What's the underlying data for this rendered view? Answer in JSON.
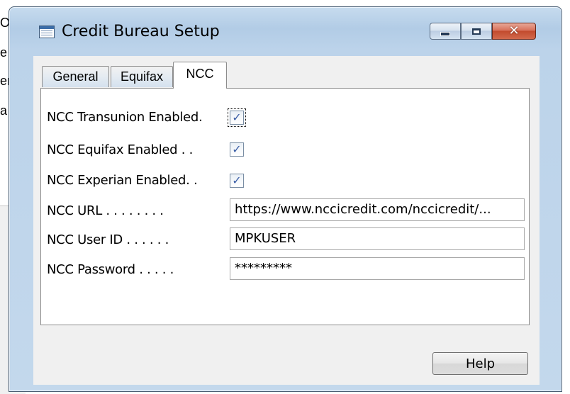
{
  "background": {
    "fragments": [
      "Of",
      "e",
      "er",
      "a"
    ]
  },
  "window": {
    "title": "Credit Bureau Setup",
    "icon": "table-window-icon",
    "controls": {
      "minimize": "minimize-icon",
      "maximize": "maximize-icon",
      "close": "✕"
    }
  },
  "tabs": [
    {
      "label": "General",
      "active": false
    },
    {
      "label": "Equifax",
      "active": false
    },
    {
      "label": "NCC",
      "active": true
    }
  ],
  "fields": {
    "transunion_enabled": {
      "label": "NCC Transunion Enabled.",
      "checked": true
    },
    "equifax_enabled": {
      "label": "NCC Equifax Enabled . .",
      "checked": true
    },
    "experian_enabled": {
      "label": "NCC Experian Enabled. .",
      "checked": true
    },
    "url": {
      "label": "NCC URL . . . . . . . .",
      "value": "https://www.nccicredit.com/nccicredit/..."
    },
    "user_id": {
      "label": "NCC User ID . . . . . .",
      "value": "MPKUSER"
    },
    "password": {
      "label": "NCC Password . . . . .",
      "value": "*********"
    }
  },
  "buttons": {
    "help": "Help"
  },
  "check_mark": "✓",
  "colors": {
    "title_bar": "#b9d1ea",
    "close_button": "#c24b2e",
    "check_color": "#3a5da6"
  }
}
